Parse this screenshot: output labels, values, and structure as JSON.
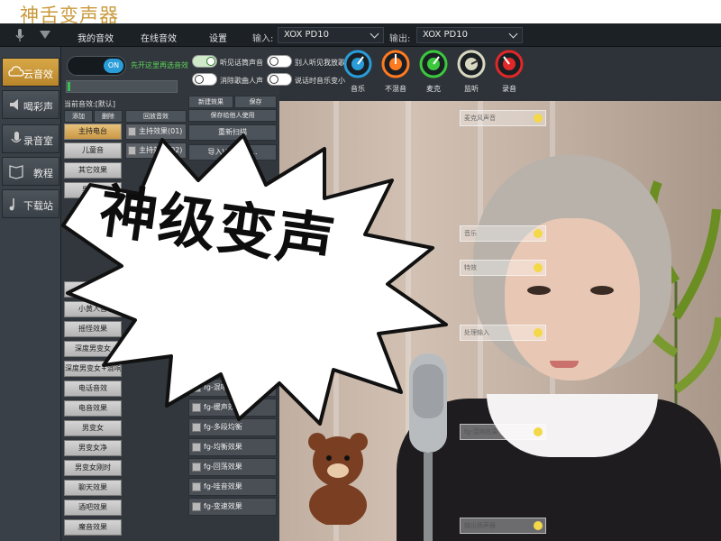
{
  "app": {
    "title": "神舌变声器"
  },
  "topbar": {
    "tabs": [
      "我的音效",
      "在线音效",
      "设置"
    ],
    "input_label": "输入:",
    "input_device": "XOX PD10",
    "output_label": "输出:",
    "output_device": "XOX PD10"
  },
  "sidebar": {
    "items": [
      {
        "label": "云音效",
        "icon": "cloud-icon",
        "active": true
      },
      {
        "label": "喝彩声",
        "icon": "speaker-icon",
        "active": false
      },
      {
        "label": "录音室",
        "icon": "microphone-icon",
        "active": false
      },
      {
        "label": "教程",
        "icon": "book-icon",
        "active": false
      },
      {
        "label": "下载站",
        "icon": "music-note-icon",
        "active": false
      }
    ]
  },
  "panel": {
    "toggle_label": "ON",
    "hint": "先开这里再选音效",
    "current_label": "当前音效:[默认]",
    "add_label": "添加",
    "delete_label": "删除",
    "back_label": "回放音效",
    "new_label": "新建效果",
    "save_label": "保存",
    "save_share_label": "保存给他人使用",
    "rescan_label": "重新扫描",
    "import_label": "导入VST插件...",
    "presets": [
      "主持电台",
      "儿童音",
      "其它效果",
      "男变女",
      "女变男",
      "小黄人音",
      "摇怪效果",
      "深度男变女",
      "深度男变女+混响",
      "电话音效",
      "电音效果",
      "男变女",
      "男变女净",
      "男变女刚时",
      "聊天效果",
      "酒吧效果",
      "魔音效果"
    ],
    "effects": [
      "主持效果(01)",
      "主持效果(02)"
    ],
    "fx_list": [
      "fg-混响效果",
      "fg-缓声效果",
      "fg-多段均衡",
      "fg-均衡效果",
      "fg-回荡效果",
      "fg-哇音效果",
      "fg-变速效果"
    ]
  },
  "options": {
    "o1": "听见话筒声音",
    "o2": "消除歌曲人声",
    "o3": "别人听见我放歌",
    "o4": "说话时音乐变小"
  },
  "knobs": [
    {
      "label": "音乐",
      "color": "#2a9cd8"
    },
    {
      "label": "不混音",
      "color": "#ff7a20"
    },
    {
      "label": "麦克",
      "color": "#3cc83c"
    },
    {
      "label": "监听",
      "color": "#d8d8c0"
    },
    {
      "label": "录音",
      "color": "#e02828"
    }
  ],
  "overlay": {
    "caption": "神级变声",
    "boxes": [
      "麦克风声音",
      "音乐",
      "特效",
      "处理输入",
      "fg-混响效果",
      "输出扬声器"
    ]
  }
}
